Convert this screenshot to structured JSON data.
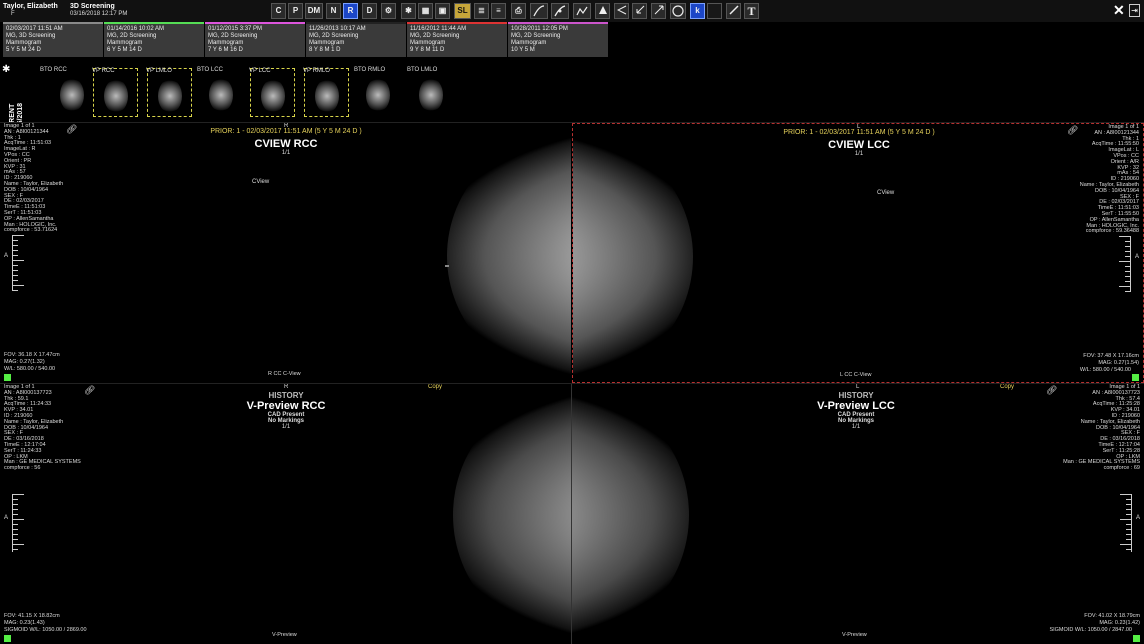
{
  "patient": {
    "name": "Taylor, Elizabeth",
    "sex": "F",
    "study": "3D Screening",
    "date": "03/16/2018 12:17 PM"
  },
  "toolbar": {
    "btn_c": "C",
    "btn_p": "P",
    "btn_dm": "DM",
    "btn_n": "N",
    "btn_r": "R",
    "btn_d": "D",
    "btn_sl": "SL",
    "btn_k": "k",
    "btn_t": "T"
  },
  "studies": [
    {
      "date": "02/03/2017 11:51 AM",
      "type": "MG, 3D Screening",
      "modality": "Mammogram",
      "age": "5 Y 5 M 24 D",
      "accent": "#8a8a8a"
    },
    {
      "date": "01/14/2016 10:02 AM",
      "type": "MG, 2D Screening",
      "modality": "Mammogram",
      "age": "6 Y 5 M 14 D",
      "accent": "#55dd55"
    },
    {
      "date": "01/12/2015 3:37 PM",
      "type": "MG, 2D Screening",
      "modality": "Mammogram",
      "age": "7 Y 6 M 16 D",
      "accent": "#dd55dd"
    },
    {
      "date": "11/26/2013 10:17 AM",
      "type": "MG, 2D Screening",
      "modality": "Mammogram",
      "age": "8 Y 8 M 1 D",
      "accent": "#222222"
    },
    {
      "date": "11/16/2012 11:44 AM",
      "type": "MG, 2D Screening",
      "modality": "Mammogram",
      "age": "9 Y 8 M 11 D",
      "accent": "#dd3333"
    },
    {
      "date": "10/28/2011 12:05 PM",
      "type": "MG, 2D Screening",
      "modality": "Mammogram",
      "age": "10 Y 5 M",
      "accent": "#cc55cc"
    }
  ],
  "current": {
    "label": "CURRENT",
    "date": "03/16/2018"
  },
  "thumbnails": [
    {
      "label": "BTO RCC",
      "selected": false
    },
    {
      "label": "VP RCC",
      "selected": true
    },
    {
      "label": "VP LMLO",
      "selected": true
    },
    {
      "label": "BTO LCC",
      "selected": false
    },
    {
      "label": "VP LCC",
      "selected": true
    },
    {
      "label": "VP RMLO",
      "selected": true
    },
    {
      "label": "BTO RMLO",
      "selected": false
    },
    {
      "label": "BTO LMLO",
      "selected": false
    }
  ],
  "vp_rcc": {
    "prior": "PRIOR: 1 - 02/03/2017 11:51 AM (5 Y 5 M 24 D )",
    "side": "R",
    "title": "CVIEW RCC",
    "count": "1/1",
    "cview": "CView",
    "info": [
      "Image 1 of 1",
      "AN : A8I00121344",
      "Thk : 1",
      "AcqTime : 11:51:03",
      "ImageLat : R",
      "VPos : CC",
      "Orient : PR",
      "KVP : 31",
      "mAs : 57",
      "ID : 219060",
      "Name : Taylor, Elizabeth",
      "DOB : 10/04/1964",
      "SEX : F",
      "DE : 02/03/2017",
      "TimeE : 11:51:03",
      "SerT : 11:51:03",
      "OP : AllenSamantha",
      "Man : HOLOGIC, Inc.",
      "compforce : 53.71624"
    ],
    "a": "A",
    "fov": "FOV: 36.18 X 17.47cm",
    "mag": "MAG: 0.27(1.32)",
    "wl": "W/L: 580.00 / 540.00",
    "bottom": "R CC C-View"
  },
  "vp_lcc": {
    "prior": "PRIOR: 1 - 02/03/2017 11:51 AM (5 Y 5 M 24 D )",
    "side": "L",
    "title": "CVIEW LCC",
    "count": "1/1",
    "cview": "CView",
    "info": [
      "Image 1 of 1",
      "AN : A8I00121344",
      "Thk : 1",
      "AcqTime : 11:55:50",
      "ImageLat : L",
      "VPos : CC",
      "Orient : A/R",
      "KVP : 32",
      "mAs : 54",
      "ID : 219060",
      "Name : Taylor, Elizabeth",
      "DOB : 10/04/1964",
      "SEX : F",
      "DE : 02/03/2017",
      "TimeE : 11:51:03",
      "SerT : 11:55:50",
      "OP : AllenSamantha",
      "Man : HOLOGIC, Inc.",
      "compforce : 59.36488"
    ],
    "a": "A",
    "fov": "FOV: 37.48 X 17.16cm",
    "mag": "MAG: 0.27(1.54)",
    "wl": "W/L: 580.00 / 540.00",
    "bottom": "L CC C-View"
  },
  "vp_vrcc": {
    "side": "R",
    "history": "HISTORY",
    "copy": "Copy",
    "title": "V-Preview RCC",
    "cad": "CAD Present",
    "mark": "No Markings",
    "count": "1/1",
    "info": [
      "Image 1 of 1",
      "AN : A8I000137723",
      "Thk : 59.1",
      "AcqTime : 11:24:33",
      "KVP : 34.01",
      "ID : 219060",
      "Name : Taylor, Elizabeth",
      "DOB : 10/04/1964",
      "SEX : F",
      "DE : 03/16/2018",
      "TimeE : 12:17:04",
      "SerT : 11:24:33",
      "OP : LKM",
      "Man : GE MEDICAL SYSTEMS",
      "compforce : 56"
    ],
    "a": "A",
    "fov": "FOV: 41.15 X 18.82cm",
    "mag": "MAG: 0.23(1.43)",
    "wl": "SIGMOID W/L: 1050.00 / 2869.00",
    "bottom": "V-Preview"
  },
  "vp_vlcc": {
    "side": "L",
    "history": "HISTORY",
    "copy": "Copy",
    "title": "V-Preview LCC",
    "cad": "CAD Present",
    "mark": "No Markings",
    "count": "1/1",
    "info": [
      "Image 1 of 1",
      "AN : A8I000137723",
      "Thk : 57.4",
      "AcqTime : 11:25:28",
      "KVP : 34.01",
      "ID : 219060",
      "Name : Taylor, Elizabeth",
      "DOB : 10/04/1964",
      "SEX : F",
      "DE : 03/16/2018",
      "TimeE : 12:17:04",
      "SerT : 11:25:28",
      "OP : LKM",
      "Man : GE MEDICAL SYSTEMS",
      "compforce : 69"
    ],
    "a": "A",
    "fov": "FOV: 41.02 X 18.79cm",
    "mag": "MAG: 0.23(1.42)",
    "wl": "SIGMOID W/L: 1050.00 / 2847.00",
    "bottom": "V-Preview"
  }
}
